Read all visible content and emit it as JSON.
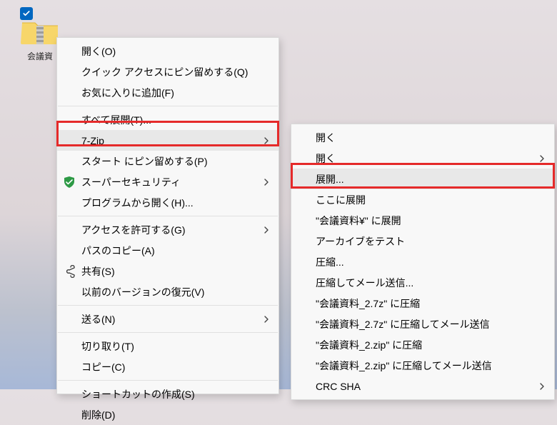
{
  "desktop": {
    "icon_label": "会議資"
  },
  "menu1": {
    "open": "開く(O)",
    "pin_quick": "クイック アクセスにピン留めする(Q)",
    "add_fav": "お気に入りに追加(F)",
    "extract_all": "すべて展開(T)...",
    "seven_zip": "7-Zip",
    "pin_start": "スタート にピン留めする(P)",
    "super_security": "スーパーセキュリティ",
    "open_with": "プログラムから開く(H)...",
    "grant_access": "アクセスを許可する(G)",
    "copy_path": "パスのコピー(A)",
    "share": "共有(S)",
    "restore_prev": "以前のバージョンの復元(V)",
    "send_to": "送る(N)",
    "cut": "切り取り(T)",
    "copy": "コピー(C)",
    "create_shortcut": "ショートカットの作成(S)",
    "delete": "削除(D)"
  },
  "menu2": {
    "open1": "開く",
    "open2": "開く",
    "extract": "展開...",
    "extract_here": "ここに展開",
    "extract_to": "\"会議資料¥\" に展開",
    "test": "アーカイブをテスト",
    "compress": "圧縮...",
    "compress_mail": "圧縮してメール送信...",
    "comp_7z": "\"会議資料_2.7z\" に圧縮",
    "comp_7z_mail": "\"会議資料_2.7z\" に圧縮してメール送信",
    "comp_zip": "\"会議資料_2.zip\" に圧縮",
    "comp_zip_mail": "\"会議資料_2.zip\" に圧縮してメール送信",
    "crc": "CRC SHA"
  }
}
